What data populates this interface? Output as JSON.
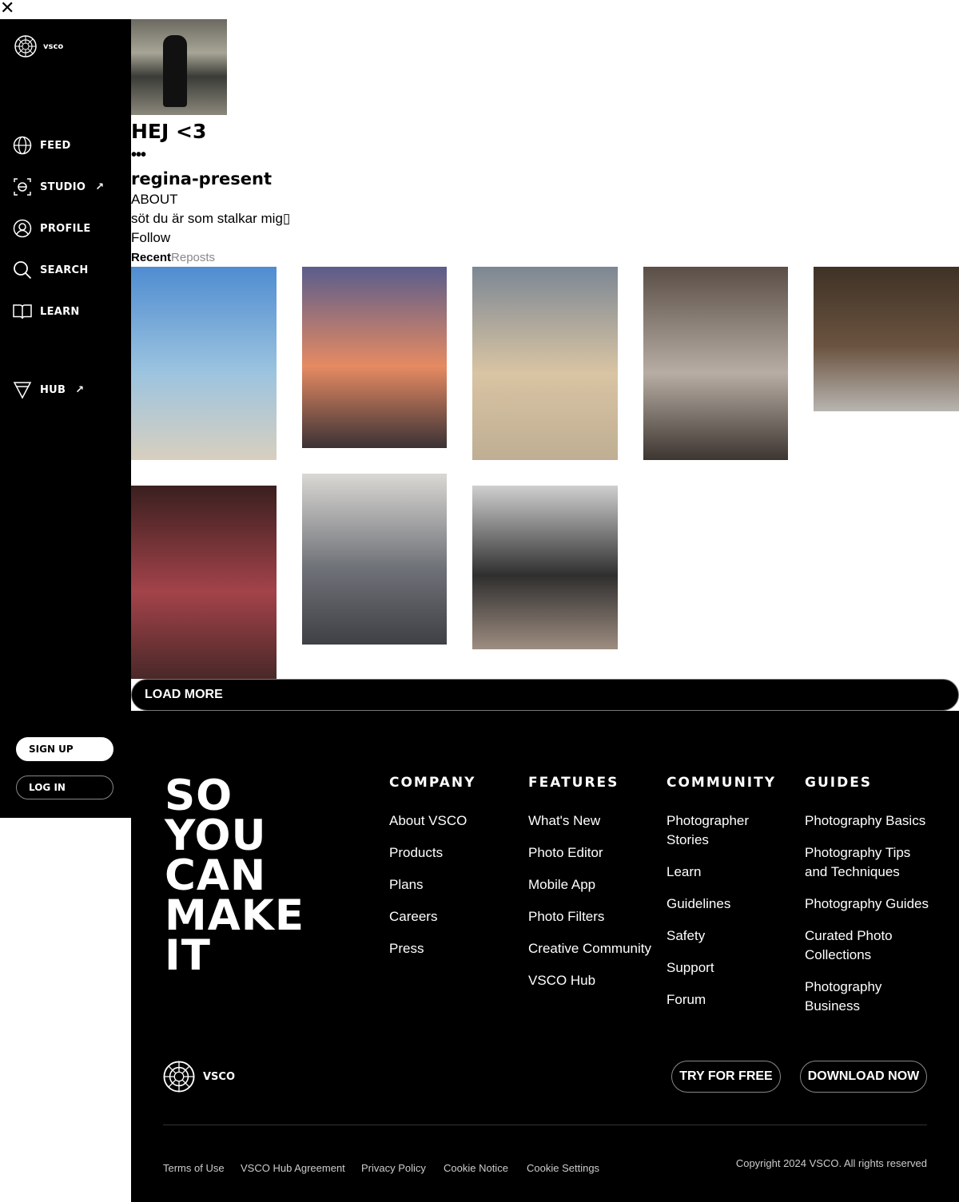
{
  "close_label": "✕",
  "sidebar": {
    "logo_text": "vsco",
    "nav": [
      {
        "label": "FEED",
        "icon": "globe-icon"
      },
      {
        "label": "STUDIO",
        "icon": "studio-icon",
        "external": "↗"
      },
      {
        "label": "PROFILE",
        "icon": "profile-icon"
      },
      {
        "label": "SEARCH",
        "icon": "search-icon"
      },
      {
        "label": "LEARN",
        "icon": "book-icon"
      },
      {
        "label": "HUB",
        "icon": "hub-icon",
        "external": "↗"
      }
    ],
    "signup_label": "SIGN UP",
    "login_label": "LOG IN"
  },
  "profile": {
    "title": "HEJ <3",
    "more": "•••",
    "username": "regina-present",
    "about_label": "ABOUT",
    "bio": "söt du är som stalkar mig▯",
    "follow_label": "Follow",
    "tabs": {
      "recent": "Recent",
      "reposts": "Reposts"
    }
  },
  "gallery": {
    "photos": [
      {
        "name": "photo-beach-hat",
        "colors": [
          "#4f8cd1",
          "#9cc4df",
          "#d8cfbf"
        ]
      },
      {
        "name": "photo-sunset-friends",
        "colors": [
          "#5a5d8c",
          "#e68a62",
          "#3b3236"
        ]
      },
      {
        "name": "photo-beach-pig",
        "colors": [
          "#7c8794",
          "#d9c4a3",
          "#bfae93"
        ]
      },
      {
        "name": "photo-bathroom-mirror",
        "colors": [
          "#5a4e46",
          "#b7ada4",
          "#3d3530"
        ]
      },
      {
        "name": "photo-bag-suitcase",
        "colors": [
          "#3e3226",
          "#6b5340",
          "#b8b5b0"
        ]
      },
      {
        "name": "photo-red-room",
        "colors": [
          "#3a1f1f",
          "#a3434a",
          "#4a2828"
        ]
      },
      {
        "name": "photo-airplane-cabin",
        "colors": [
          "#dad8d4",
          "#6f7278",
          "#3f4046"
        ]
      },
      {
        "name": "photo-mirror-selfie",
        "colors": [
          "#cfcfcf",
          "#2f2f2f",
          "#9e8d80"
        ]
      }
    ],
    "load_more_label": "LOAD MORE"
  },
  "footer": {
    "slogan": "SO YOU CAN MAKE IT",
    "columns": [
      {
        "heading": "COMPANY",
        "links": [
          "About VSCO",
          "Products",
          "Plans",
          "Careers",
          "Press"
        ]
      },
      {
        "heading": "FEATURES",
        "links": [
          "What's New",
          "Photo Editor",
          "Mobile App",
          "Photo Filters",
          "Creative Community",
          "VSCO Hub"
        ]
      },
      {
        "heading": "COMMUNITY",
        "links": [
          "Photographer Stories",
          "Learn",
          "Guidelines",
          "Safety",
          "Support",
          "Forum"
        ]
      },
      {
        "heading": "GUIDES",
        "links": [
          "Photography Basics",
          "Photography Tips and Techniques",
          "Photography Guides",
          "Curated Photo Collections",
          "Photography Business"
        ]
      }
    ],
    "logo_text": "VSCO",
    "try_label": "TRY FOR FREE",
    "download_label": "DOWNLOAD NOW",
    "legal": [
      "Terms of Use",
      "VSCO Hub Agreement",
      "Privacy Policy",
      "Cookie Notice",
      "Cookie Settings"
    ],
    "copyright": "Copyright 2024 VSCO. All rights reserved"
  }
}
